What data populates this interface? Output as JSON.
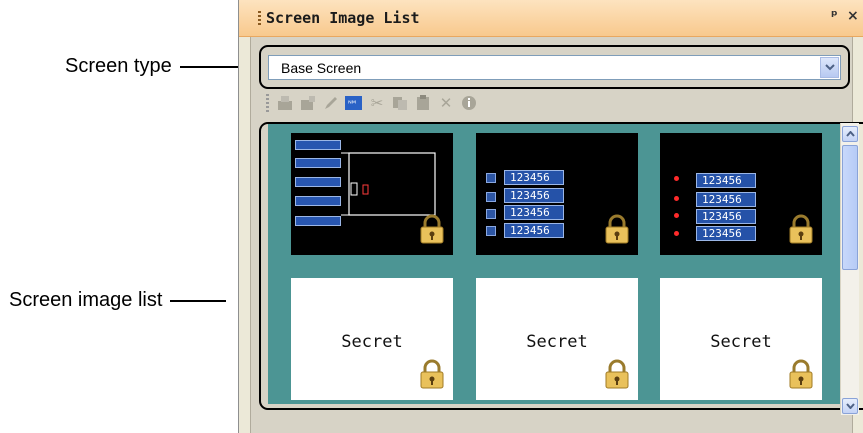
{
  "annotations": {
    "screen_type": "Screen type",
    "screen_image_list": "Screen image list"
  },
  "panel": {
    "title": "Screen Image List",
    "pin_icon": "pin-icon",
    "close_icon": "close-icon"
  },
  "screen_type_select": {
    "value": "Base Screen"
  },
  "toolbar": {
    "icons": [
      "open-icon",
      "new-screen-icon",
      "pencil-icon",
      "id-icon",
      "cut-icon",
      "copy-icon",
      "paste-icon",
      "delete-icon",
      "info-icon"
    ]
  },
  "screen_list": {
    "thumb1": {
      "type": "switch-lamp-screen"
    },
    "thumb2": {
      "numbers": [
        "123456",
        "123456",
        "123456",
        "123456"
      ]
    },
    "thumb3": {
      "numbers": [
        "123456",
        "123456",
        "123456",
        "123456"
      ]
    },
    "secret_labels": [
      "Secret",
      "Secret",
      "Secret"
    ]
  },
  "colors": {
    "list_background": "#4c9594",
    "title_gradient_top": "#fde3bf",
    "title_gradient_bottom": "#f8c98d",
    "number_box": "#2552a8",
    "lamp_red": "#ff2b2b"
  }
}
